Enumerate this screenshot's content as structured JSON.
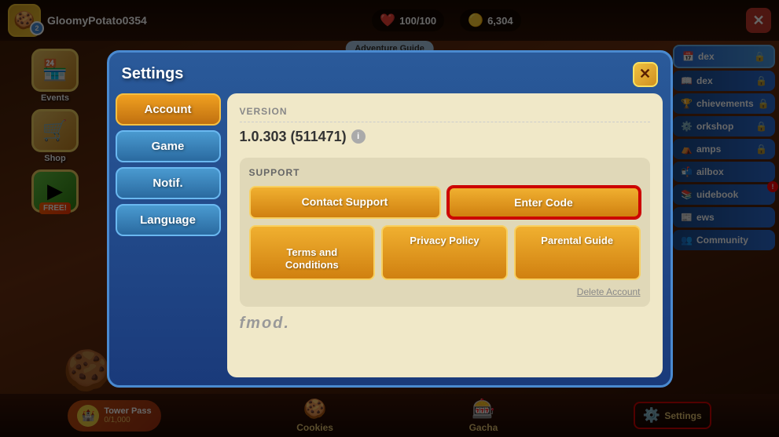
{
  "player": {
    "name": "GloomyPotato0354",
    "level": "2",
    "avatar_emoji": "🍪"
  },
  "stats": {
    "health": "100/100",
    "coins": "6,304"
  },
  "top_bar": {
    "close_label": "✕"
  },
  "adventure_guide": {
    "label": "Adventure Guide"
  },
  "left_sidebar": {
    "items": [
      {
        "icon": "🏪",
        "label": "Events"
      },
      {
        "icon": "🛒",
        "label": "Shop"
      },
      {
        "icon": "▶",
        "label": "FREE!"
      }
    ]
  },
  "right_sidebar": {
    "items": [
      {
        "label": "dex",
        "locked": true
      },
      {
        "label": "chievements",
        "locked": true
      },
      {
        "label": "orkshop",
        "locked": true
      },
      {
        "label": "amps",
        "locked": true
      },
      {
        "label": "ailbox",
        "locked": false
      },
      {
        "label": "uidebook",
        "locked": false,
        "alert": true
      },
      {
        "label": "ews",
        "locked": false
      }
    ],
    "community_label": "Community"
  },
  "bottom_bar": {
    "tower_pass_label": "Tower Pass",
    "tower_pass_count": "0",
    "tower_pass_max": "0/1,000",
    "cookies_label": "Cookies",
    "gacha_label": "Gacha",
    "settings_label": "Settings"
  },
  "modal": {
    "title": "Settings",
    "close_label": "✕",
    "tabs": [
      {
        "label": "Account",
        "active": true
      },
      {
        "label": "Game",
        "active": false
      },
      {
        "label": "Notif.",
        "active": false
      },
      {
        "label": "Language",
        "active": false
      }
    ],
    "content": {
      "version_section": {
        "label": "Version",
        "value": "1.0.303 (511471)",
        "info": "i"
      },
      "support_section": {
        "title": "Support",
        "contact_support_label": "Contact Support",
        "enter_code_label": "Enter Code",
        "terms_label": "Terms and\nConditions",
        "privacy_label": "Privacy Policy",
        "parental_label": "Parental Guide",
        "delete_label": "Delete Account",
        "fmod_label": "fmod."
      }
    }
  }
}
